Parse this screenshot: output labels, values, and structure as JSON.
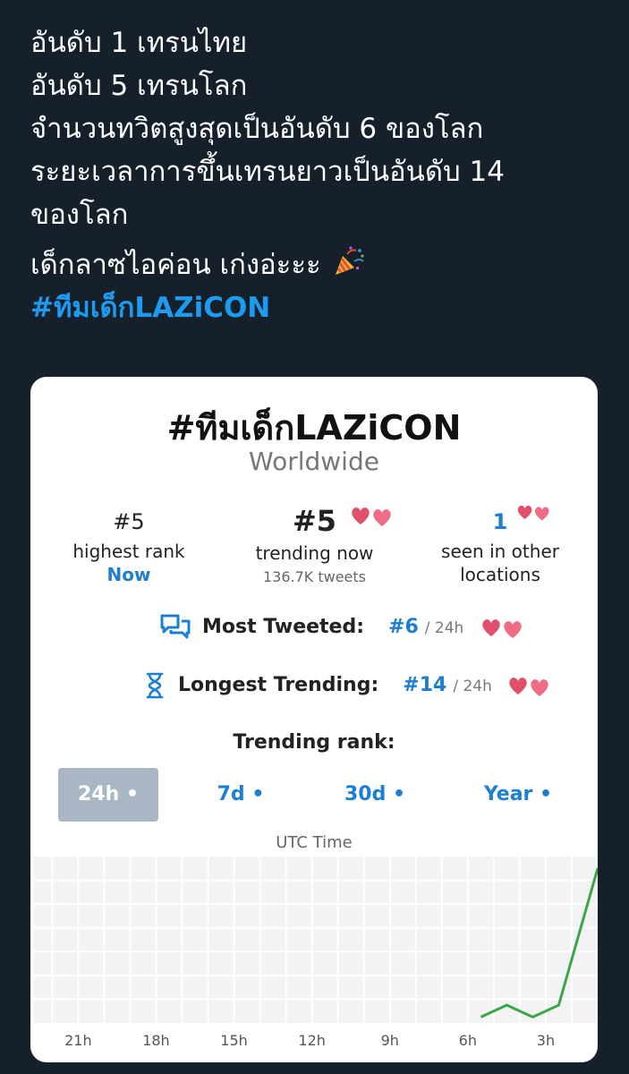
{
  "tweet": {
    "lines": [
      "อันดับ 1 เทรนไทย",
      "อันดับ 5 เทรนโลก",
      "จำนวนทวิตสูงสุดเป็นอันดับ 6 ของโลก",
      "ระยะเวลาการขึ้นเทรนยาวเป็นอันดับ 14",
      "ของโลก"
    ],
    "closing": "เด็กลาซไอค่อน เก่งอ่ะะะ",
    "hashtag": "#ทีมเด็กLAZiCON",
    "colors": {
      "background": "#15202b",
      "text": "#ffffff",
      "hashtag": "#1d9bf0"
    }
  },
  "card": {
    "title": "#ทีมเด็กLAZiCON",
    "subtitle": "Worldwide",
    "stats": [
      {
        "value": "#5",
        "label": "highest rank",
        "sub": "Now"
      },
      {
        "value": "#5",
        "label": "trending now",
        "sub": "136.7K tweets"
      },
      {
        "value": "1",
        "label": "seen in other",
        "label2": "locations"
      }
    ],
    "most_tweeted": {
      "label": "Most Tweeted:",
      "rank": "#6",
      "period": "/ 24h"
    },
    "longest_trending": {
      "label": "Longest Trending:",
      "rank": "#14",
      "period": "/ 24h"
    },
    "trending_rank_label": "Trending rank:",
    "tabs": [
      "24h •",
      "7d •",
      "30d •",
      "Year •"
    ],
    "active_tab": "24h •",
    "utc_label": "UTC Time",
    "accent_color": "#1c7fd1"
  },
  "chart_data": {
    "type": "line",
    "x": [
      "21h",
      "18h",
      "15h",
      "12h",
      "9h",
      "6h",
      "3h"
    ],
    "series": [
      {
        "color": "#3aa64a",
        "points": [
          [
            5.5,
            1
          ],
          [
            4.5,
            3
          ],
          [
            3.5,
            1
          ],
          [
            2.5,
            3
          ],
          [
            1,
            26
          ]
        ]
      }
    ],
    "xrange": [
      22.7,
      1
    ],
    "yrange": [
      0,
      28
    ],
    "grid": true,
    "ylabel": "",
    "xlabel": "UTC Time"
  }
}
